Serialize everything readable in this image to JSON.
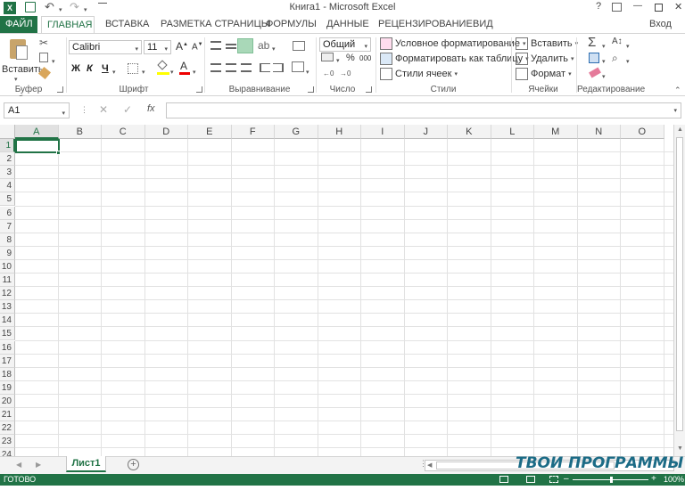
{
  "window": {
    "title": "Книга1 - Microsoft Excel",
    "help": "?",
    "minimize": "—",
    "close": "✕",
    "login": "Вход"
  },
  "tabs": [
    "ФАЙЛ",
    "ГЛАВНАЯ",
    "ВСТАВКА",
    "РАЗМЕТКА СТРАНИЦЫ",
    "ФОРМУЛЫ",
    "ДАННЫЕ",
    "РЕЦЕНЗИРОВАНИЕ",
    "ВИД"
  ],
  "ribbon": {
    "clipboard": {
      "label": "Буфер обмена",
      "paste": "Вставить"
    },
    "font": {
      "label": "Шрифт",
      "name": "Calibri",
      "size": "11",
      "bold": "Ж",
      "italic": "К",
      "underline": "Ч",
      "grow": "A",
      "shrink": "A",
      "fontcolor": "A"
    },
    "alignment": {
      "label": "Выравнивание"
    },
    "number": {
      "label": "Число",
      "format": "Общий",
      "percent": "%",
      "thousands": "000"
    },
    "styles": {
      "label": "Стили",
      "conditional": "Условное форматирование",
      "as_table": "Форматировать как таблицу",
      "cell_styles": "Стили ячеек"
    },
    "cells": {
      "label": "Ячейки",
      "insert": "Вставить",
      "delete": "Удалить",
      "format": "Формат"
    },
    "editing": {
      "label": "Редактирование",
      "sum": "Σ"
    }
  },
  "formula_bar": {
    "name_box": "A1",
    "fx": "fx",
    "value": ""
  },
  "grid": {
    "columns": [
      "A",
      "B",
      "C",
      "D",
      "E",
      "F",
      "G",
      "H",
      "I",
      "J",
      "K",
      "L",
      "M",
      "N",
      "O"
    ],
    "rows": [
      "1",
      "2",
      "3",
      "4",
      "5",
      "6",
      "7",
      "8",
      "9",
      "10",
      "11",
      "12",
      "13",
      "14",
      "15",
      "16",
      "17",
      "18",
      "19",
      "20",
      "21",
      "22",
      "23",
      "24"
    ],
    "selected": "A1"
  },
  "sheets": [
    "Лист1"
  ],
  "status": {
    "ready": "ГОТОВО",
    "zoom": "100%"
  },
  "watermark": "ТВОИ ПРОГРАММЫ РУ",
  "colors": {
    "accent": "#217346"
  }
}
